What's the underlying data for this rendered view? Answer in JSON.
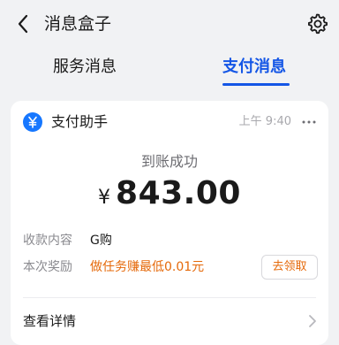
{
  "header": {
    "title": "消息盒子"
  },
  "tabs": [
    {
      "label": "服务消息"
    },
    {
      "label": "支付消息"
    }
  ],
  "card": {
    "app_name": "支付助手",
    "time": "上午 9:40",
    "status": "到账成功",
    "currency_symbol": "¥",
    "amount": "843.00",
    "details": [
      {
        "label": "收款内容",
        "value": "G购"
      },
      {
        "label": "本次奖励",
        "value": "做任务赚最低0.01元"
      }
    ],
    "claim_label": "去领取",
    "view_detail_label": "查看详情"
  },
  "colors": {
    "accent": "#1456e6",
    "reward": "#e5690a",
    "background": "#f1f2f4"
  }
}
